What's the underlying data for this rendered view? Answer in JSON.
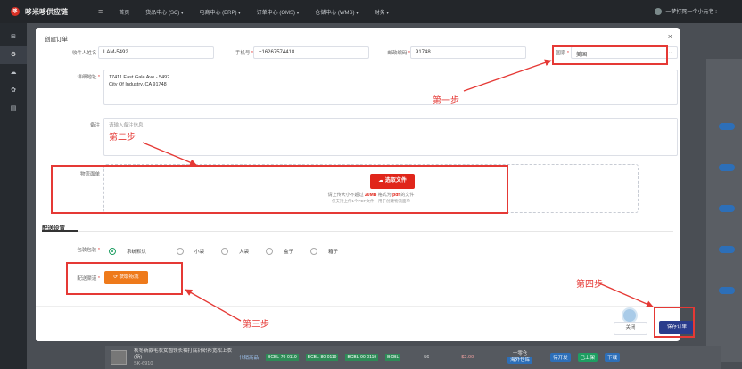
{
  "topbar": {
    "logo": "哆",
    "title": "哆米哆供应链",
    "menu_icon": "menu-icon",
    "nav": [
      {
        "label": "首页",
        "caret": ""
      },
      {
        "label": "货品中心 (SC)",
        "caret": "▾"
      },
      {
        "label": "电商中心 (ERP)",
        "caret": "▾"
      },
      {
        "label": "订单中心 (OMS)",
        "caret": "▾"
      },
      {
        "label": "仓储中心 (WMS)",
        "caret": "▾"
      },
      {
        "label": "财务",
        "caret": "▾"
      }
    ],
    "user": "一梦打死一个小元老 ⁝"
  },
  "sidebar": {
    "items": [
      {
        "icon": "home-icon",
        "glyph": "⊞"
      },
      {
        "icon": "settings-icon",
        "glyph": "⚙"
      },
      {
        "icon": "cloud-icon",
        "glyph": "☁"
      },
      {
        "icon": "gear-icon",
        "glyph": "✿"
      },
      {
        "icon": "document-icon",
        "glyph": "▤"
      }
    ]
  },
  "modal": {
    "title": "创建订单",
    "close": "×",
    "fields": {
      "recipient_label": "收件人姓名",
      "recipient_value": "LAM-5492",
      "phone_label": "手机号",
      "phone_value": "+16267574418",
      "zip_label": "邮政编码",
      "zip_value": "91748",
      "country_label": "国家",
      "country_value": "美国",
      "country_caret": "⌄",
      "address_label": "详细地址",
      "address_line1": "17411 East Gale Ave - 5492",
      "address_line2": "City Of Industry, CA 91748",
      "remark_label": "备注",
      "remark_placeholder": "请输入备注信息",
      "logistics_label": "物流面单"
    },
    "upload": {
      "button": "☁ 选取文件",
      "hint_prefix": "请上传大小不超过",
      "hint_size": "20MB",
      "hint_mid": "格式为",
      "hint_type": "pdf",
      "hint_suffix": "的文件",
      "hint2": "仅支持上传1个PDF文件，用于创建物流面单"
    },
    "delivery": {
      "section_title": "配送设置",
      "packaging_label": "包装包装",
      "options": [
        "系统默认",
        "小袋",
        "大袋",
        "盒子",
        "箱子"
      ],
      "selected": "系统默认",
      "channel_label": "配送渠道",
      "fetch_button": "⟳ 获取物流"
    },
    "footer": {
      "close": "关闭",
      "save": "保存订单"
    }
  },
  "annotations": {
    "step1": "第一步",
    "step2": "第二步",
    "step3": "第三步",
    "step4": "第四步",
    "color": "#e53935"
  },
  "background": {
    "row_product": "秋冬新款毛衣女圆领长袖打底针织衫宽松上衣(新)",
    "row_sku_sub": "SK-6910",
    "row_status": "代销商品",
    "sku_tags": [
      "BCBL-70-0119",
      "BCBL-80-0119",
      "BCBL-90-0119",
      "BCBL"
    ],
    "row_code": "56",
    "row_price": "$2.00",
    "row_stock": "一零仓",
    "row_stock_sub": "海外仓库",
    "row_tag1": "待开发",
    "row_tag2": "已上架",
    "row_tag3": "下载"
  }
}
